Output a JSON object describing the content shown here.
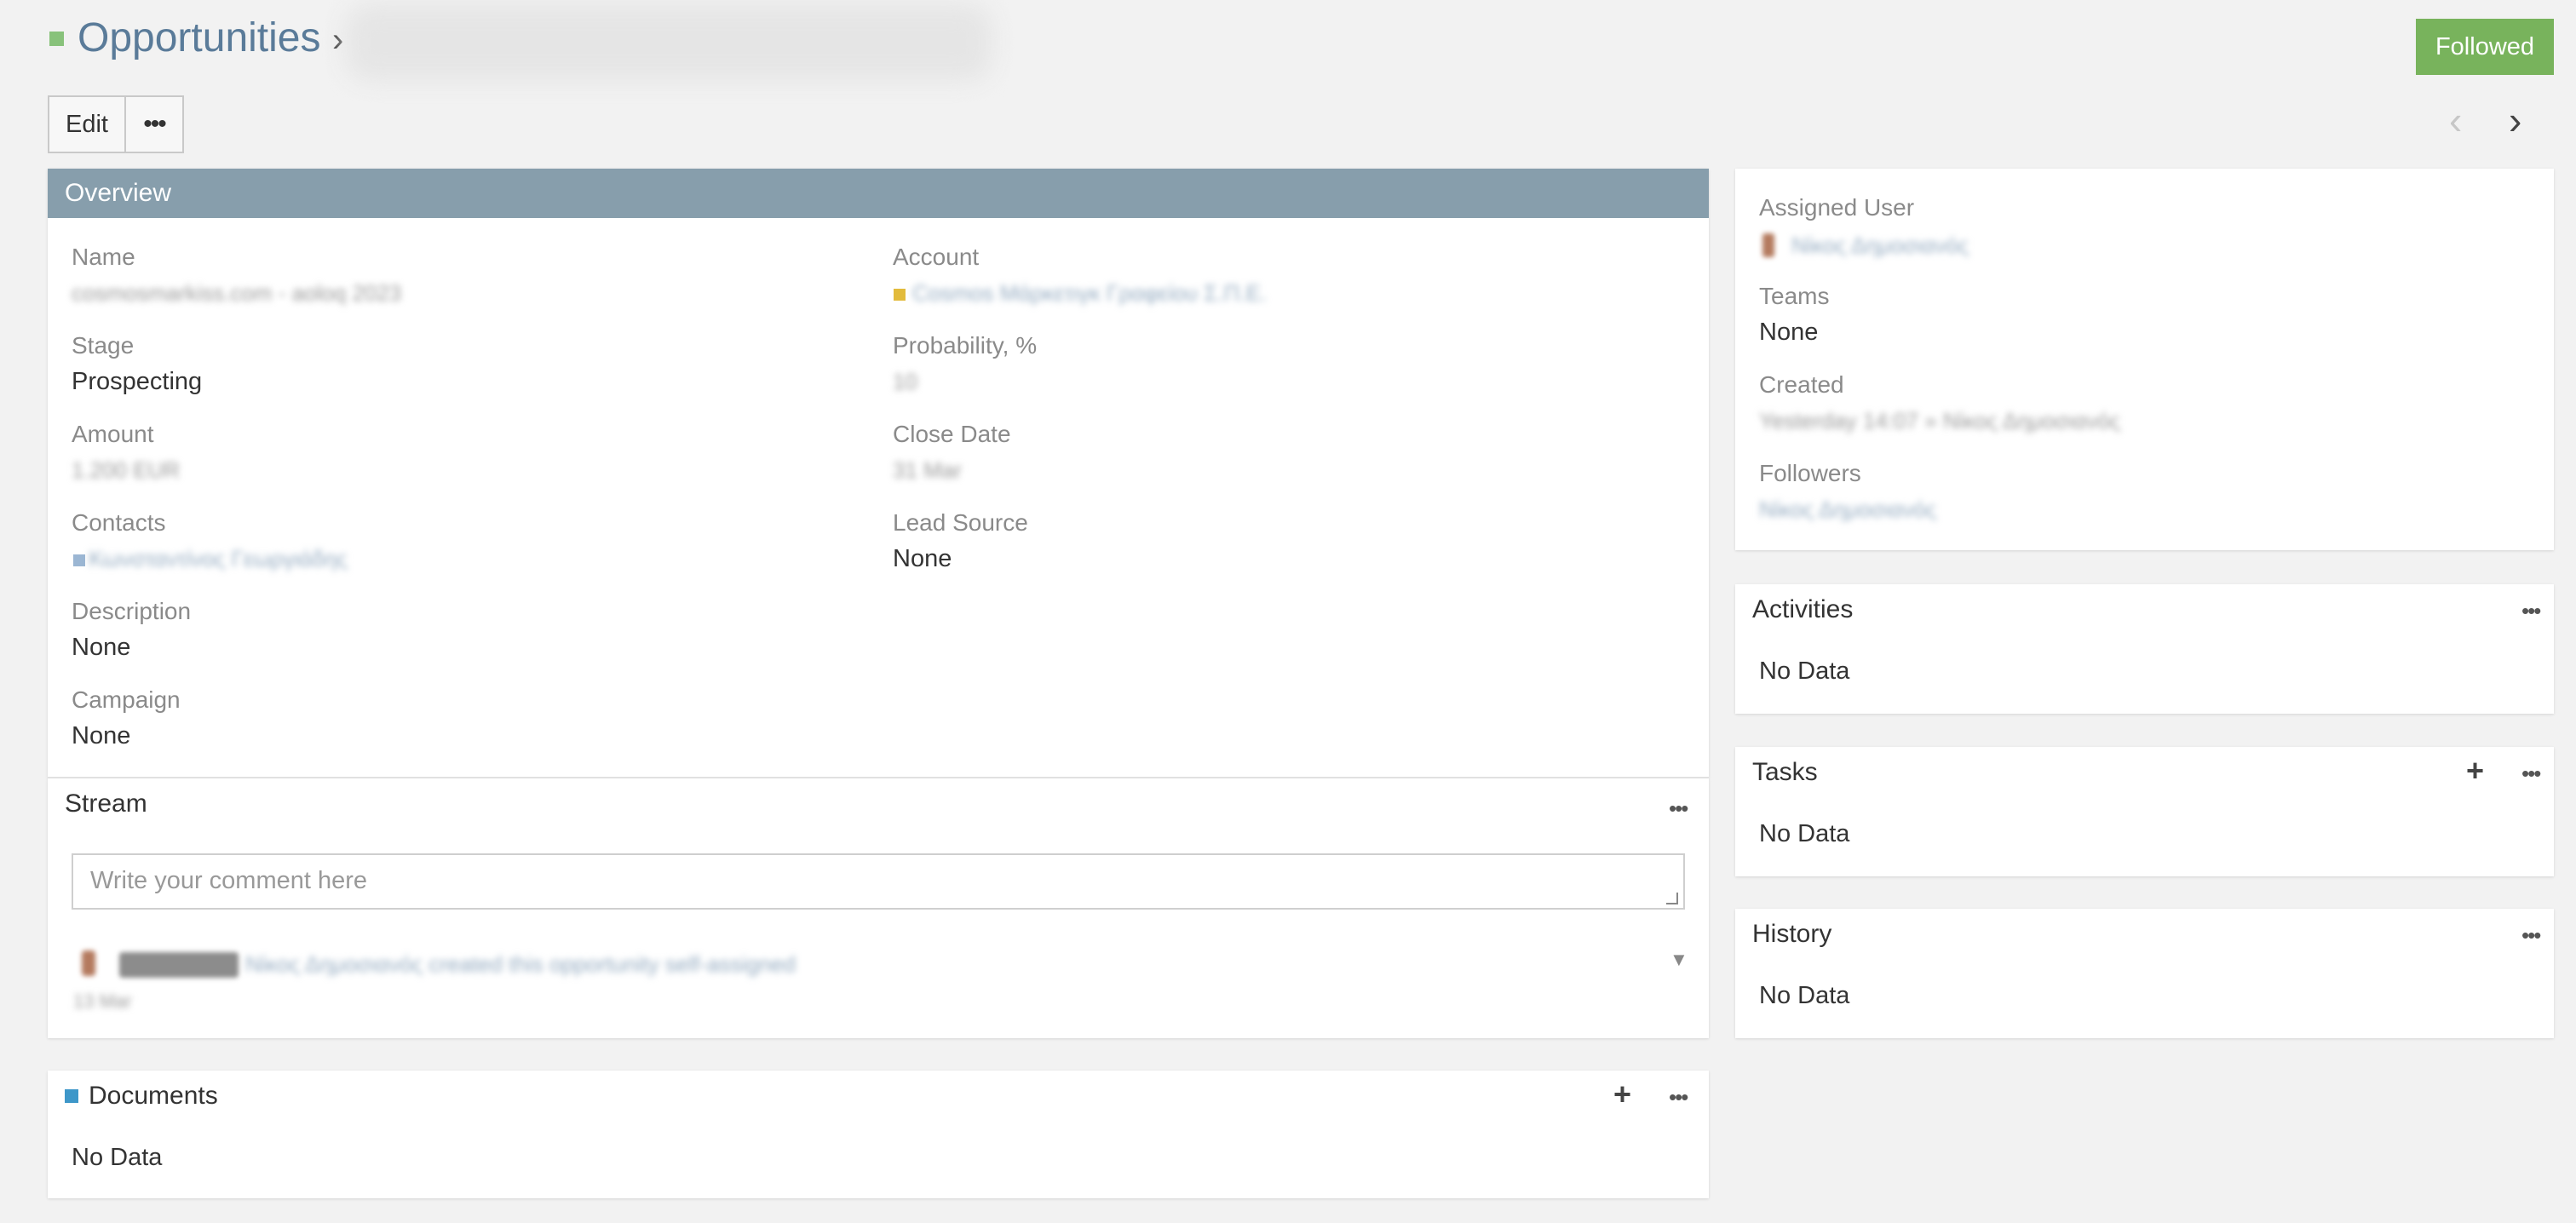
{
  "header": {
    "title": "Opportunities",
    "chevron": "›",
    "followed_label": "Followed",
    "colors": {
      "title": "#5a7b99",
      "followed": "#78b35c",
      "title_square": "#88c27b"
    }
  },
  "actions": {
    "edit_label": "Edit",
    "more_label": "•••",
    "prev_icon": "‹",
    "next_icon": "›"
  },
  "overview": {
    "heading": "Overview",
    "header_color": "#879eac",
    "fields": {
      "name": {
        "label": "Name",
        "value": "cosmosmarkiss.com - aoloq 2023"
      },
      "account": {
        "label": "Account",
        "value": "Cosmos Μάρκετιγκ Γραφείου Σ.Π.Ε."
      },
      "stage": {
        "label": "Stage",
        "value": "Prospecting"
      },
      "probability": {
        "label": "Probability, %",
        "value": "10"
      },
      "amount": {
        "label": "Amount",
        "value": "1.200 EUR"
      },
      "close_date": {
        "label": "Close Date",
        "value": "31 Mar"
      },
      "contacts": {
        "label": "Contacts",
        "value": "Κωνσταντίνος Γεωργιάδης"
      },
      "lead_source": {
        "label": "Lead Source",
        "value": "None"
      },
      "description": {
        "label": "Description",
        "value": "None"
      },
      "campaign": {
        "label": "Campaign",
        "value": "None"
      }
    }
  },
  "stream": {
    "heading": "Stream",
    "more_label": "•••",
    "comment_placeholder": "Write your comment here",
    "entry": {
      "badge": "Prospecting",
      "text": "Νίκος Δημοσιανός created this opportunity self-assigned",
      "time": "13 Mar"
    }
  },
  "documents": {
    "heading": "Documents",
    "add_label": "+",
    "more_label": "•••",
    "empty": "No Data"
  },
  "side": {
    "assigned_user": {
      "label": "Assigned User",
      "value": "Νίκος Δημοσιανός"
    },
    "teams": {
      "label": "Teams",
      "value": "None"
    },
    "created": {
      "label": "Created",
      "value": "Yesterday 14:07 » Νίκος Δημοσιανός"
    },
    "followers": {
      "label": "Followers",
      "value": "Νίκος Δημοσιανός"
    }
  },
  "activities": {
    "heading": "Activities",
    "more_label": "•••",
    "empty": "No Data"
  },
  "tasks": {
    "heading": "Tasks",
    "add_label": "+",
    "more_label": "•••",
    "empty": "No Data"
  },
  "history": {
    "heading": "History",
    "more_label": "•••",
    "empty": "No Data"
  }
}
